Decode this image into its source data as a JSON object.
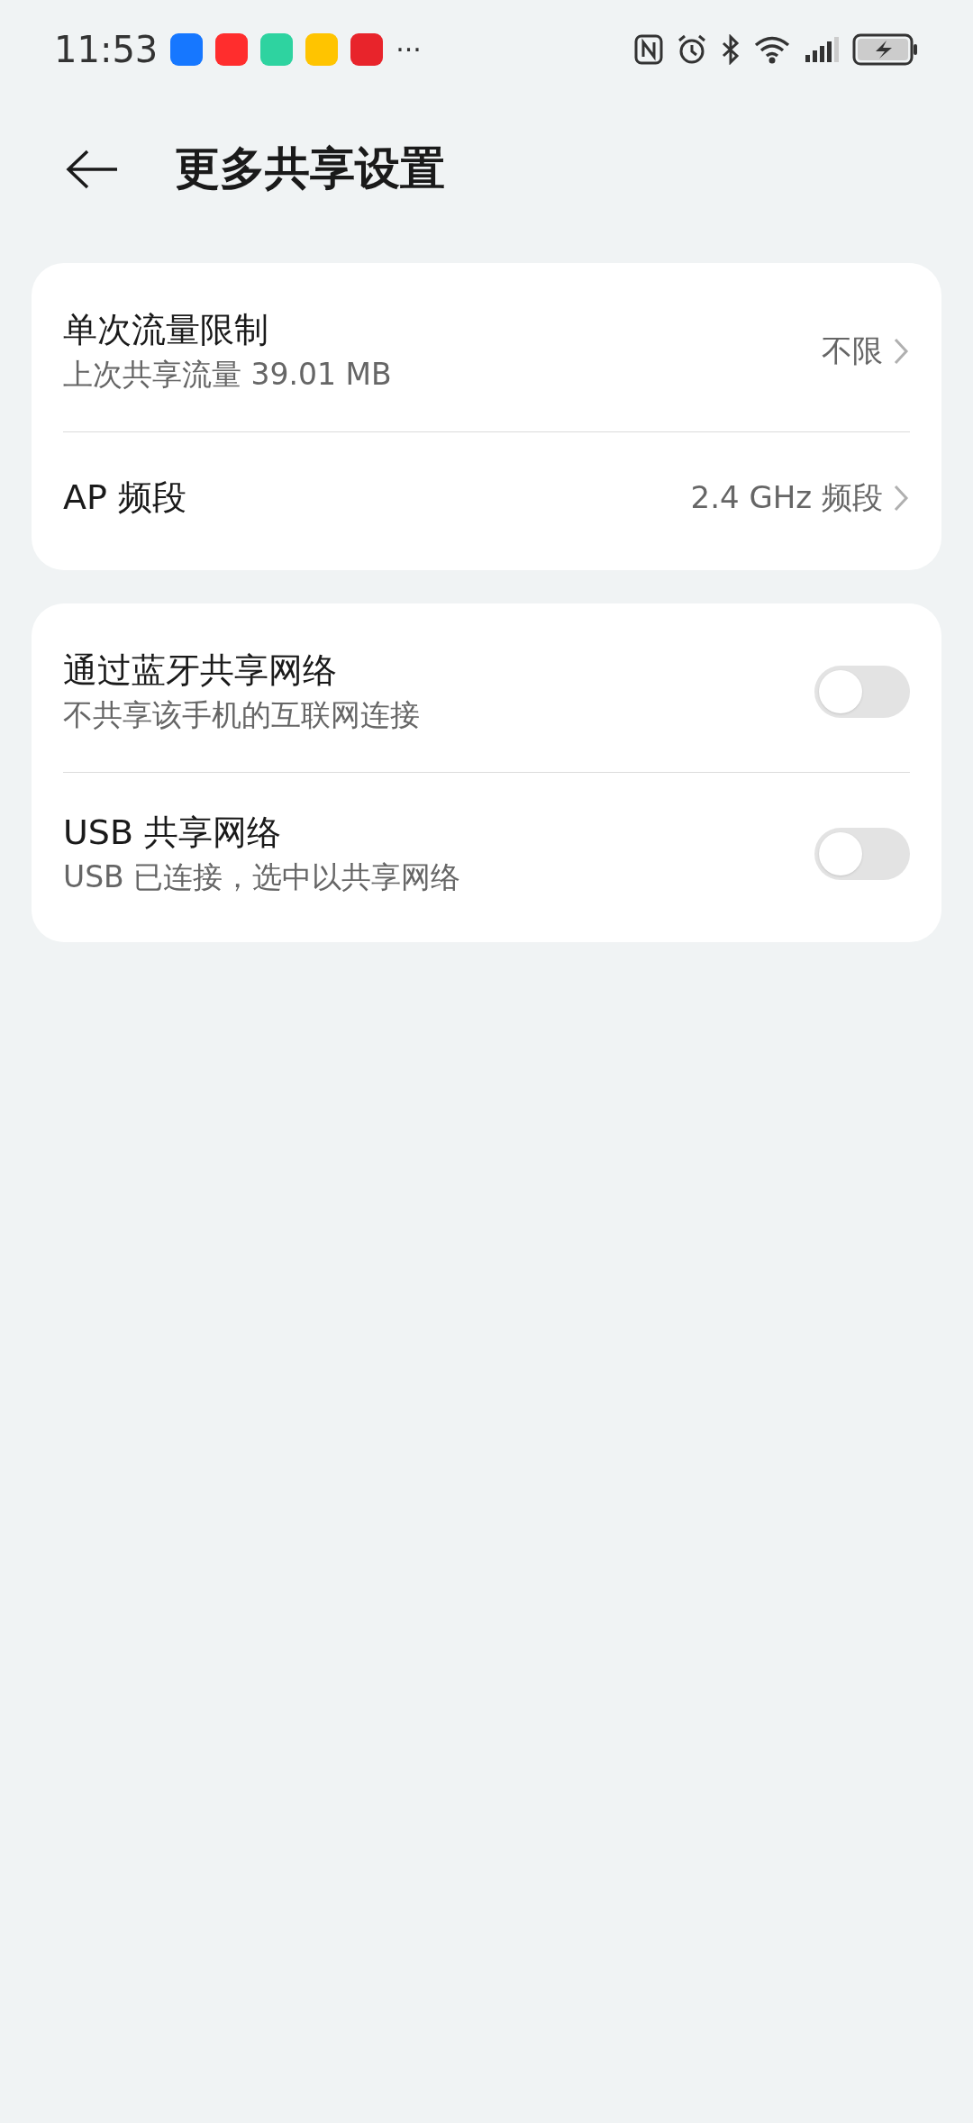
{
  "status_bar": {
    "time": "11:53",
    "overflow": "···"
  },
  "header": {
    "title": "更多共享设置"
  },
  "groups": [
    {
      "items": [
        {
          "kind": "value",
          "title": "单次流量限制",
          "subtitle": "上次共享流量 39.01 MB",
          "value": "不限"
        },
        {
          "kind": "value",
          "title": "AP 频段",
          "value": "2.4 GHz 频段"
        }
      ]
    },
    {
      "items": [
        {
          "kind": "toggle",
          "title": "通过蓝牙共享网络",
          "subtitle": "不共享该手机的互联网连接",
          "on": false
        },
        {
          "kind": "toggle",
          "title": "USB 共享网络",
          "subtitle": "USB 已连接，选中以共享网络",
          "on": false
        }
      ]
    }
  ]
}
